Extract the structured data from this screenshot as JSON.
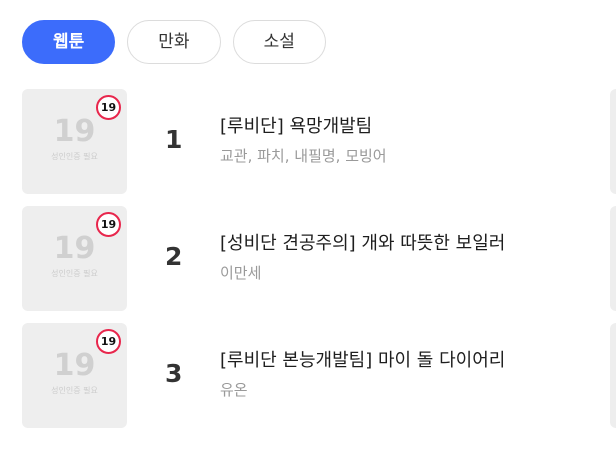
{
  "tabs": [
    {
      "label": "웹툰",
      "active": true
    },
    {
      "label": "만화",
      "active": false
    },
    {
      "label": "소설",
      "active": false
    }
  ],
  "items": [
    {
      "rank": "1",
      "title": "[루비단] 욕망개발팀",
      "authors": "교관, 파치, 내필명, 모빙어",
      "thumb_number": "19",
      "thumb_caption": "성인인증 필요",
      "age_badge": "19"
    },
    {
      "rank": "2",
      "title": "[성비단 견공주의] 개와 따뜻한 보일러",
      "authors": "이만세",
      "thumb_number": "19",
      "thumb_caption": "성인인증 필요",
      "age_badge": "19"
    },
    {
      "rank": "3",
      "title": "[루비단 본능개발팀] 마이 돌 다이어리",
      "authors": "유온",
      "thumb_number": "19",
      "thumb_caption": "성인인증 필요",
      "age_badge": "19"
    }
  ],
  "colors": {
    "accent": "#3c6cfb",
    "age_badge_border": "#e8264c",
    "thumb_bg": "#eeeeee"
  }
}
